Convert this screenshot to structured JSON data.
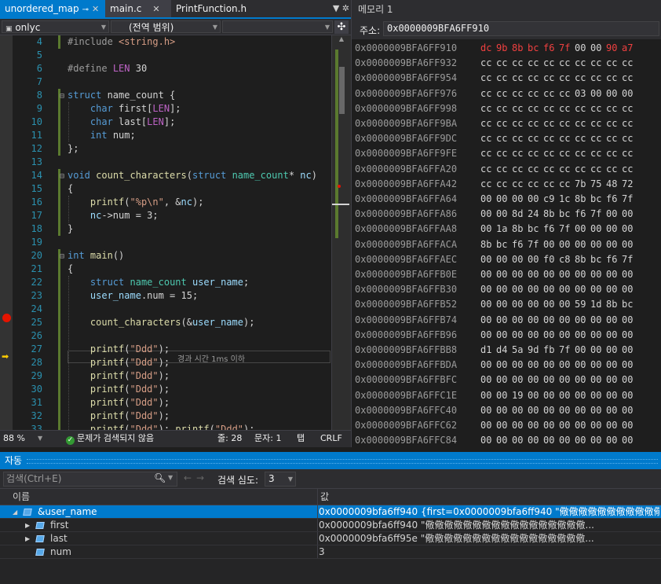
{
  "editor": {
    "tabs": [
      {
        "label": "unordered_map",
        "pin": "⊸",
        "close": "✕"
      },
      {
        "label": "main.c",
        "close": "✕"
      },
      {
        "label": "PrintFunction.h"
      }
    ],
    "nav": {
      "project": "onlyc",
      "scope": "(전역 범위)"
    },
    "lines": [
      {
        "n": "4",
        "html": "<span class='pp'>#include</span> <span class='str'>&lt;string.h&gt;</span>"
      },
      {
        "n": "5",
        "html": ""
      },
      {
        "n": "6",
        "html": "<span class='pp'>#define</span> <span class='mac'>LEN</span> 30"
      },
      {
        "n": "7",
        "html": ""
      },
      {
        "n": "8",
        "html": "<span class='kw'>struct</span> name_count {",
        "fold": "⊟"
      },
      {
        "n": "9",
        "html": "    <span class='kw'>char</span> first[<span class='mac'>LEN</span>];"
      },
      {
        "n": "10",
        "html": "    <span class='kw'>char</span> last[<span class='mac'>LEN</span>];"
      },
      {
        "n": "11",
        "html": "    <span class='kw'>int</span> num;"
      },
      {
        "n": "12",
        "html": "};"
      },
      {
        "n": "13",
        "html": ""
      },
      {
        "n": "14",
        "html": "<span class='kw'>void</span> <span class='fn'>count_characters</span>(<span class='kw'>struct</span> <span class='ty'>name_count</span>* <span class='var'>nc</span>)",
        "fold": "⊟"
      },
      {
        "n": "15",
        "html": "{"
      },
      {
        "n": "16",
        "html": "    <span class='fn'>printf</span>(<span class='str'>\"%p\\n\"</span>, &amp;<span class='var'>nc</span>);"
      },
      {
        "n": "17",
        "html": "    <span class='var'>nc</span>-&gt;num = 3;"
      },
      {
        "n": "18",
        "html": "}"
      },
      {
        "n": "19",
        "html": ""
      },
      {
        "n": "20",
        "html": "<span class='kw'>int</span> <span class='fn'>main</span>()",
        "fold": "⊟"
      },
      {
        "n": "21",
        "html": "{"
      },
      {
        "n": "22",
        "html": "    <span class='kw'>struct</span> <span class='ty'>name_count</span> <span class='var'>user_name</span>;"
      },
      {
        "n": "23",
        "html": "    <span class='var'>user_name</span>.num = 15;"
      },
      {
        "n": "24",
        "html": ""
      },
      {
        "n": "25",
        "html": "    <span class='fn'>count_characters</span>(&amp;<span class='var'>user_name</span>);"
      },
      {
        "n": "26",
        "html": ""
      },
      {
        "n": "27",
        "html": "    <span class='fn'>printf</span>(<span class='str'>\"Ddd\"</span>);"
      },
      {
        "n": "28",
        "html": "    <span class='fn'>printf</span>(<span class='str'>\"Ddd\"</span>);"
      },
      {
        "n": "29",
        "html": "    <span class='fn'>printf</span>(<span class='str'>\"Ddd\"</span>);"
      },
      {
        "n": "30",
        "html": "    <span class='fn'>printf</span>(<span class='str'>\"Ddd\"</span>);"
      },
      {
        "n": "31",
        "html": "    <span class='fn'>printf</span>(<span class='str'>\"Ddd\"</span>);"
      },
      {
        "n": "32",
        "html": "    <span class='fn'>printf</span>(<span class='str'>\"Ddd\"</span>);"
      },
      {
        "n": "33",
        "html": "    <span class='fn'>printf</span>(<span class='str'>\"Ddd\"</span>); <span class='fn'>printf</span>(<span class='str'>\"Ddd\"</span>);"
      }
    ],
    "perf_tip": "경과 시간 1ms 이하",
    "status": {
      "zoom": "88 %",
      "issues": "문제가 검색되지 않음",
      "line": "줄: 28",
      "col": "문자: 1",
      "tab": "탭",
      "eol": "CRLF"
    }
  },
  "memory": {
    "title": "메모리 1",
    "address_label": "주소:",
    "address_value": "0x0000009BFA6FF910",
    "rows": [
      {
        "addr": "0x0000009BFA6FF910",
        "bytes": [
          "dc",
          "9b",
          "8b",
          "bc",
          "f6",
          "7f",
          "00",
          "00",
          "90",
          "a7"
        ],
        "changed": [
          0,
          1,
          2,
          3,
          4,
          5,
          8,
          9
        ]
      },
      {
        "addr": "0x0000009BFA6FF932",
        "bytes": [
          "cc",
          "cc",
          "cc",
          "cc",
          "cc",
          "cc",
          "cc",
          "cc",
          "cc",
          "cc"
        ]
      },
      {
        "addr": "0x0000009BFA6FF954",
        "bytes": [
          "cc",
          "cc",
          "cc",
          "cc",
          "cc",
          "cc",
          "cc",
          "cc",
          "cc",
          "cc"
        ]
      },
      {
        "addr": "0x0000009BFA6FF976",
        "bytes": [
          "cc",
          "cc",
          "cc",
          "cc",
          "cc",
          "cc",
          "03",
          "00",
          "00",
          "00"
        ]
      },
      {
        "addr": "0x0000009BFA6FF998",
        "bytes": [
          "cc",
          "cc",
          "cc",
          "cc",
          "cc",
          "cc",
          "cc",
          "cc",
          "cc",
          "cc"
        ]
      },
      {
        "addr": "0x0000009BFA6FF9BA",
        "bytes": [
          "cc",
          "cc",
          "cc",
          "cc",
          "cc",
          "cc",
          "cc",
          "cc",
          "cc",
          "cc"
        ]
      },
      {
        "addr": "0x0000009BFA6FF9DC",
        "bytes": [
          "cc",
          "cc",
          "cc",
          "cc",
          "cc",
          "cc",
          "cc",
          "cc",
          "cc",
          "cc"
        ]
      },
      {
        "addr": "0x0000009BFA6FF9FE",
        "bytes": [
          "cc",
          "cc",
          "cc",
          "cc",
          "cc",
          "cc",
          "cc",
          "cc",
          "cc",
          "cc"
        ]
      },
      {
        "addr": "0x0000009BFA6FFA20",
        "bytes": [
          "cc",
          "cc",
          "cc",
          "cc",
          "cc",
          "cc",
          "cc",
          "cc",
          "cc",
          "cc"
        ]
      },
      {
        "addr": "0x0000009BFA6FFA42",
        "bytes": [
          "cc",
          "cc",
          "cc",
          "cc",
          "cc",
          "cc",
          "7b",
          "75",
          "48",
          "72"
        ]
      },
      {
        "addr": "0x0000009BFA6FFA64",
        "bytes": [
          "00",
          "00",
          "00",
          "00",
          "c9",
          "1c",
          "8b",
          "bc",
          "f6",
          "7f"
        ]
      },
      {
        "addr": "0x0000009BFA6FFA86",
        "bytes": [
          "00",
          "00",
          "8d",
          "24",
          "8b",
          "bc",
          "f6",
          "7f",
          "00",
          "00"
        ]
      },
      {
        "addr": "0x0000009BFA6FFAA8",
        "bytes": [
          "00",
          "1a",
          "8b",
          "bc",
          "f6",
          "7f",
          "00",
          "00",
          "00",
          "00"
        ]
      },
      {
        "addr": "0x0000009BFA6FFACA",
        "bytes": [
          "8b",
          "bc",
          "f6",
          "7f",
          "00",
          "00",
          "00",
          "00",
          "00",
          "00"
        ]
      },
      {
        "addr": "0x0000009BFA6FFAEC",
        "bytes": [
          "00",
          "00",
          "00",
          "00",
          "f0",
          "c8",
          "8b",
          "bc",
          "f6",
          "7f"
        ]
      },
      {
        "addr": "0x0000009BFA6FFB0E",
        "bytes": [
          "00",
          "00",
          "00",
          "00",
          "00",
          "00",
          "00",
          "00",
          "00",
          "00"
        ]
      },
      {
        "addr": "0x0000009BFA6FFB30",
        "bytes": [
          "00",
          "00",
          "00",
          "00",
          "00",
          "00",
          "00",
          "00",
          "00",
          "00"
        ]
      },
      {
        "addr": "0x0000009BFA6FFB52",
        "bytes": [
          "00",
          "00",
          "00",
          "00",
          "00",
          "00",
          "59",
          "1d",
          "8b",
          "bc"
        ]
      },
      {
        "addr": "0x0000009BFA6FFB74",
        "bytes": [
          "00",
          "00",
          "00",
          "00",
          "00",
          "00",
          "00",
          "00",
          "00",
          "00"
        ]
      },
      {
        "addr": "0x0000009BFA6FFB96",
        "bytes": [
          "00",
          "00",
          "00",
          "00",
          "00",
          "00",
          "00",
          "00",
          "00",
          "00"
        ]
      },
      {
        "addr": "0x0000009BFA6FFBB8",
        "bytes": [
          "d1",
          "d4",
          "5a",
          "9d",
          "fb",
          "7f",
          "00",
          "00",
          "00",
          "00"
        ]
      },
      {
        "addr": "0x0000009BFA6FFBDA",
        "bytes": [
          "00",
          "00",
          "00",
          "00",
          "00",
          "00",
          "00",
          "00",
          "00",
          "00"
        ]
      },
      {
        "addr": "0x0000009BFA6FFBFC",
        "bytes": [
          "00",
          "00",
          "00",
          "00",
          "00",
          "00",
          "00",
          "00",
          "00",
          "00"
        ]
      },
      {
        "addr": "0x0000009BFA6FFC1E",
        "bytes": [
          "00",
          "00",
          "19",
          "00",
          "00",
          "00",
          "00",
          "00",
          "00",
          "00"
        ]
      },
      {
        "addr": "0x0000009BFA6FFC40",
        "bytes": [
          "00",
          "00",
          "00",
          "00",
          "00",
          "00",
          "00",
          "00",
          "00",
          "00"
        ]
      },
      {
        "addr": "0x0000009BFA6FFC62",
        "bytes": [
          "00",
          "00",
          "00",
          "00",
          "00",
          "00",
          "00",
          "00",
          "00",
          "00"
        ]
      },
      {
        "addr": "0x0000009BFA6FFC84",
        "bytes": [
          "00",
          "00",
          "00",
          "00",
          "00",
          "00",
          "00",
          "00",
          "00",
          "00"
        ]
      }
    ]
  },
  "autos": {
    "title": "자동",
    "search_placeholder": "검색(Ctrl+E)",
    "depth_label": "검색 심도:",
    "depth_value": "3",
    "col_name": "이름",
    "col_value": "값",
    "rows": [
      {
        "name": "&user_name",
        "value": "0x0000009bfa6ff940 {first=0x0000009bfa6ff940 \"儆儆儆儆儆儆儆儆儆儆儆儆儆儆儆...",
        "expanded": true,
        "selected": true
      },
      {
        "name": "first",
        "value": "0x0000009bfa6ff940 \"儆儆儆儆儆儆儆儆儆儆儆儆儆儆儆儆儆...",
        "expanded": false
      },
      {
        "name": "last",
        "value": "0x0000009bfa6ff95e \"儆儆儆儆儆儆儆儆儆儆儆儆儆儆儆儆儆...",
        "expanded": false
      },
      {
        "name": "num",
        "value": "3"
      }
    ]
  },
  "colors": {
    "accent": "#007acc",
    "breakpoint": "#e51400",
    "changed_byte": "#f04040"
  }
}
